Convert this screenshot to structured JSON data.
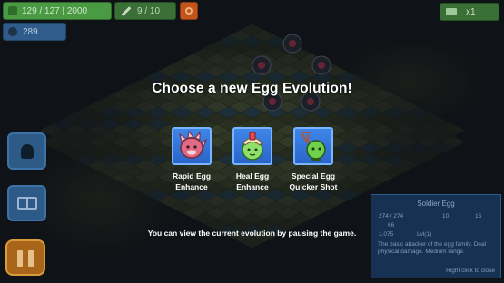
{
  "hud": {
    "health": "129 / 127 | 2000",
    "units": "9 / 10",
    "coins": "289",
    "speed": "x1"
  },
  "overlay": {
    "title": "Choose a new Egg Evolution!",
    "choices": [
      {
        "label_line1": "Rapid Egg",
        "label_line2": "Enhance",
        "icon": "spiky-pink-egg-icon"
      },
      {
        "label_line1": "Heal Egg",
        "label_line2": "Enhance",
        "icon": "green-heal-egg-icon"
      },
      {
        "label_line1": "Special Egg",
        "label_line2": "Quicker Shot",
        "icon": "green-slingshot-egg-icon"
      }
    ],
    "hint": "You can view the current evolution by pausing the game."
  },
  "info_panel": {
    "title": "Soldier Egg",
    "hp": "274 / 274",
    "stat_a": "10",
    "stat_b": "15",
    "stat_c": "66",
    "row3_a": "1.075",
    "row3_b": "Lvl(1)",
    "description": "The basic attacker of the egg family. Deal physical damage. Medium range.",
    "hint": "Right click to close"
  },
  "colors": {
    "choice_tile": "#2f6fd6",
    "pause_button": "#a9661b",
    "side_button": "#2e5a87",
    "hp_bar": "#4a9a43"
  }
}
